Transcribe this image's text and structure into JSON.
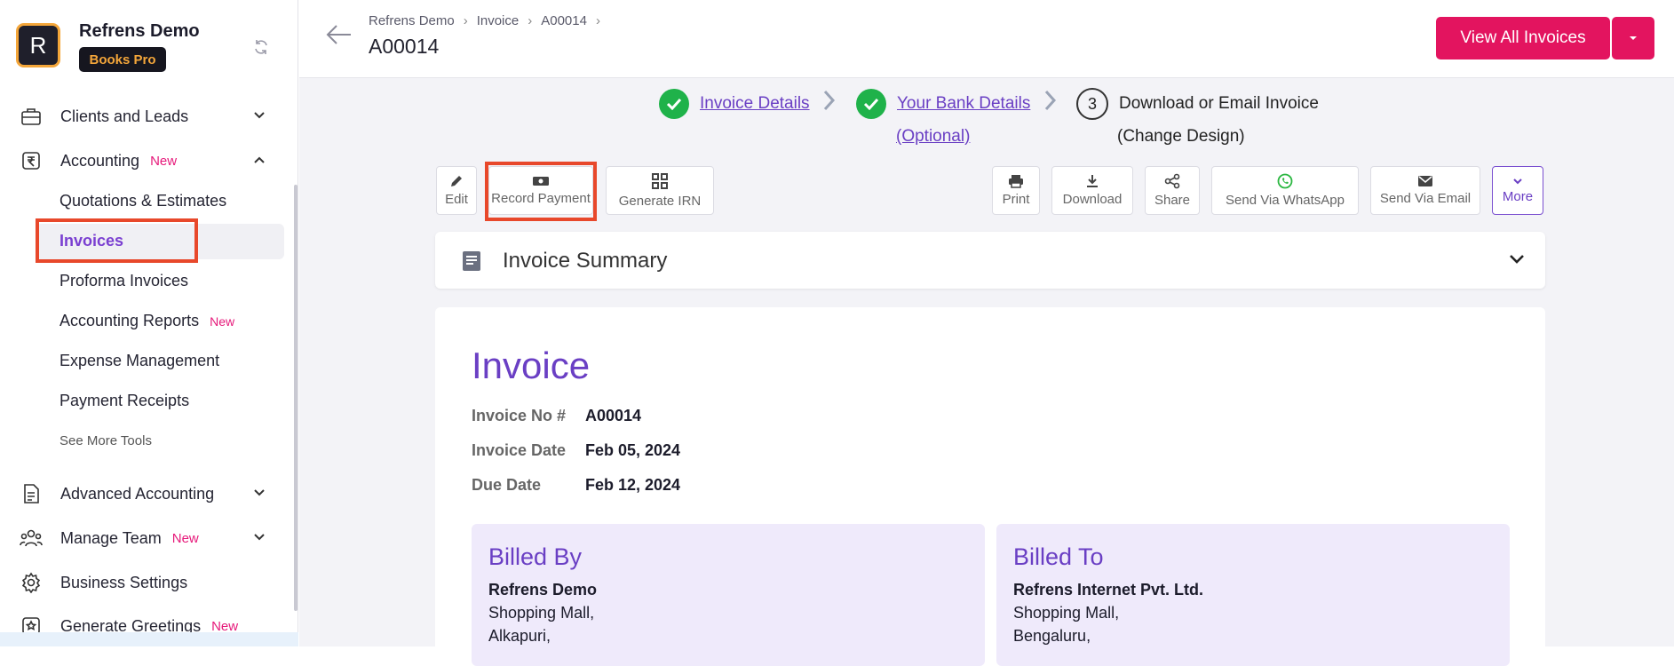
{
  "sidebar": {
    "logo_letter": "R",
    "brand": "Refrens Demo",
    "plan": "Books Pro",
    "nav": {
      "clients": "Clients and Leads",
      "accounting": "Accounting",
      "accounting_badge": "New",
      "advanced": "Advanced Accounting",
      "manage_team": "Manage Team",
      "manage_team_badge": "New",
      "business_settings": "Business Settings",
      "greetings": "Generate Greetings",
      "greetings_badge": "New"
    },
    "sub": {
      "quotations": "Quotations & Estimates",
      "invoices": "Invoices",
      "proforma": "Proforma Invoices",
      "reports": "Accounting Reports",
      "reports_badge": "New",
      "expense": "Expense Management",
      "receipts": "Payment Receipts",
      "see_more": "See More Tools"
    }
  },
  "header": {
    "breadcrumbs": [
      "Refrens Demo",
      "Invoice",
      "A00014"
    ],
    "title": "A00014",
    "view_all": "View All Invoices"
  },
  "steps": {
    "step1": "Invoice Details",
    "step2": "Your Bank Details",
    "step2_sub": "(Optional)",
    "step3_num": "3",
    "step3": "Download or Email Invoice",
    "step3_sub": "(Change Design)"
  },
  "toolbar": {
    "edit": "Edit",
    "record_payment": "Record Payment",
    "generate_irn": "Generate IRN",
    "print": "Print",
    "download": "Download",
    "share": "Share",
    "whatsapp": "Send Via WhatsApp",
    "email": "Send Via Email",
    "more": "More"
  },
  "summary": {
    "title": "Invoice Summary"
  },
  "invoice": {
    "heading": "Invoice",
    "no_label": "Invoice No #",
    "no_value": "A00014",
    "date_label": "Invoice Date",
    "date_value": "Feb 05, 2024",
    "due_label": "Due Date",
    "due_value": "Feb 12, 2024",
    "billed_by": {
      "title": "Billed By",
      "name": "Refrens Demo",
      "line1": "Shopping Mall,",
      "line2": "Alkapuri,"
    },
    "billed_to": {
      "title": "Billed To",
      "name": "Refrens Internet Pvt. Ltd.",
      "line1": "Shopping Mall,",
      "line2": "Bengaluru,"
    }
  },
  "colors": {
    "accent": "#6a3fc4",
    "primary_button": "#e3145f",
    "highlight": "#e8482b",
    "success": "#1fb24a"
  }
}
